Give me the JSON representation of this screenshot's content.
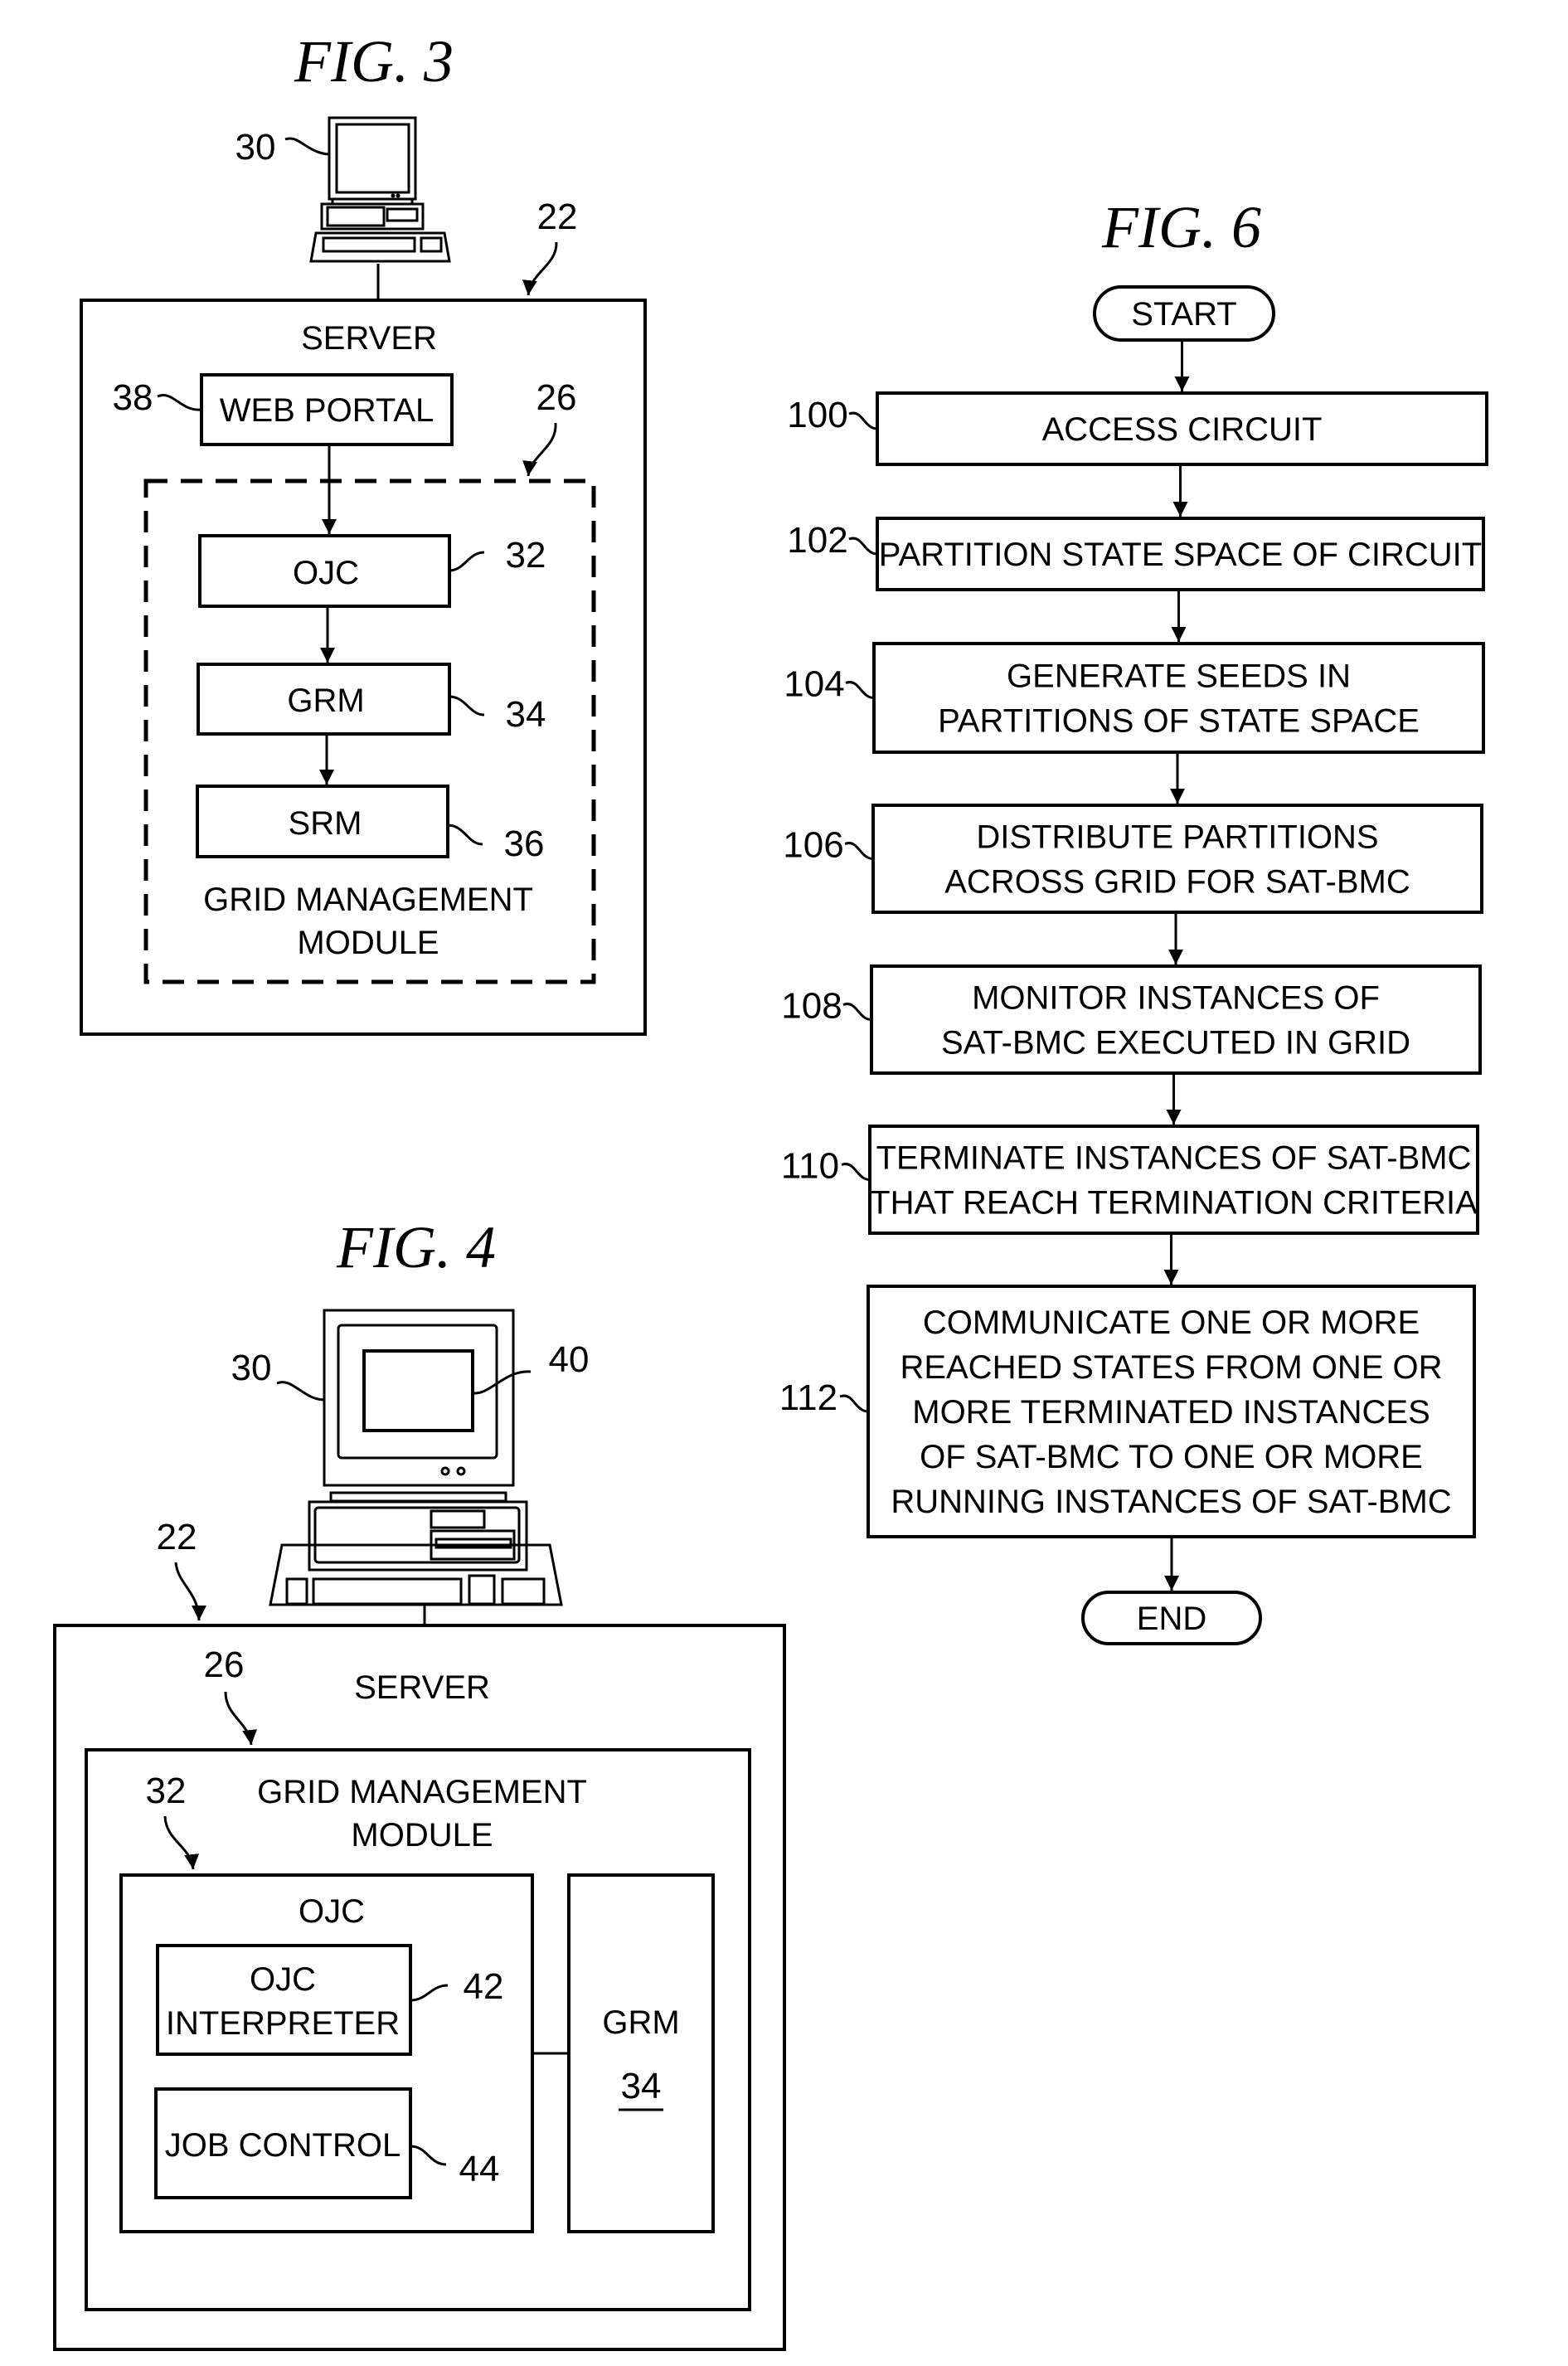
{
  "fig3": {
    "title": "FIG. 3",
    "refs": {
      "computer": "30",
      "server": "22",
      "web_portal": "38",
      "gmm": "26",
      "ojc": "32",
      "grm": "34",
      "srm": "36"
    },
    "server_label": "SERVER",
    "web_portal_label": "WEB PORTAL",
    "ojc_label": "OJC",
    "grm_label": "GRM",
    "srm_label": "SRM",
    "gmm_label_lines": [
      "GRID MANAGEMENT",
      "MODULE"
    ]
  },
  "fig4": {
    "title": "FIG. 4",
    "refs": {
      "computer": "30",
      "screen": "40",
      "server": "22",
      "gmm": "26",
      "ojc": "32",
      "interpreter": "42",
      "job_control": "44",
      "grm": "34"
    },
    "server_label": "SERVER",
    "gmm_label_lines": [
      "GRID MANAGEMENT",
      "MODULE"
    ],
    "ojc_label": "OJC",
    "interpreter_label_lines": [
      "OJC",
      "INTERPRETER"
    ],
    "job_control_label": "JOB CONTROL",
    "grm_label": "GRM"
  },
  "fig6": {
    "title": "FIG. 6",
    "start_label": "START",
    "end_label": "END",
    "steps": [
      {
        "ref": "100",
        "lines": [
          "ACCESS CIRCUIT"
        ]
      },
      {
        "ref": "102",
        "lines": [
          "PARTITION STATE SPACE OF CIRCUIT"
        ]
      },
      {
        "ref": "104",
        "lines": [
          "GENERATE SEEDS IN",
          "PARTITIONS OF STATE SPACE"
        ]
      },
      {
        "ref": "106",
        "lines": [
          "DISTRIBUTE PARTITIONS",
          "ACROSS GRID FOR SAT-BMC"
        ]
      },
      {
        "ref": "108",
        "lines": [
          "MONITOR INSTANCES OF",
          "SAT-BMC EXECUTED IN GRID"
        ]
      },
      {
        "ref": "110",
        "lines": [
          "TERMINATE INSTANCES OF SAT-BMC",
          "THAT REACH TERMINATION CRITERIA"
        ]
      },
      {
        "ref": "112",
        "lines": [
          "COMMUNICATE ONE OR MORE",
          "REACHED STATES FROM ONE OR",
          "MORE TERMINATED INSTANCES",
          "OF SAT-BMC TO ONE OR MORE",
          "RUNNING INSTANCES OF SAT-BMC"
        ]
      }
    ]
  }
}
